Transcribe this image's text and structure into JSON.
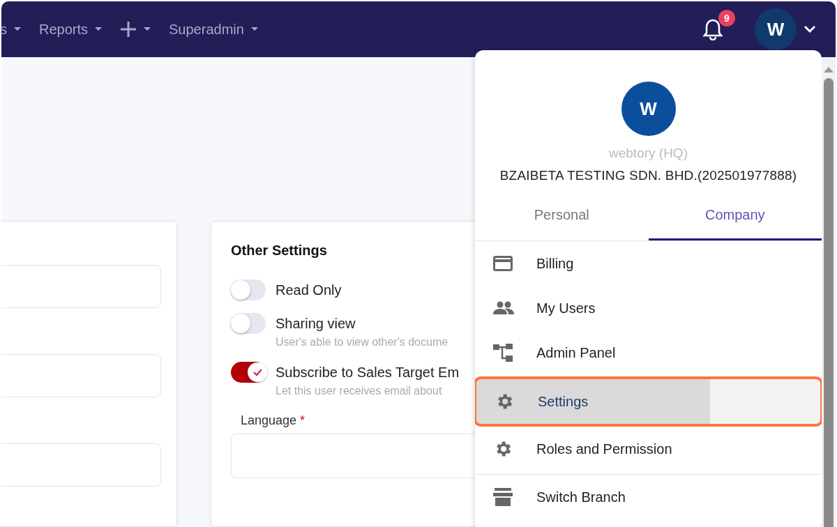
{
  "nav": {
    "items": [
      {
        "kind": "text",
        "label": "s"
      },
      {
        "kind": "text",
        "label": "Reports"
      },
      {
        "kind": "add"
      },
      {
        "kind": "text",
        "label": "Superadmin"
      }
    ],
    "notifications": {
      "count": "9"
    },
    "avatar": {
      "initial": "W"
    }
  },
  "other_settings": {
    "title": "Other Settings",
    "toggles": [
      {
        "label": "Read Only",
        "on": false
      },
      {
        "label": "Sharing view",
        "hint": "User's able to view other's docume",
        "on": false
      },
      {
        "label": "Subscribe to Sales Target Em",
        "hint": "Let this user receives email about",
        "on": true
      }
    ],
    "language": {
      "label": "Language",
      "required_mark": "*"
    }
  },
  "account_menu": {
    "avatar": "W",
    "branch": "webtory (HQ)",
    "company": "BZAIBETA TESTING SDN. BHD.(202501977888)",
    "tabs": [
      {
        "label": "Personal",
        "selected": false
      },
      {
        "label": "Company",
        "selected": true
      }
    ],
    "items": [
      {
        "kind": "card",
        "label": "Billing",
        "highlighted": false
      },
      {
        "kind": "users",
        "label": "My Users",
        "highlighted": false
      },
      {
        "kind": "tree",
        "label": "Admin Panel",
        "highlighted": false
      },
      {
        "kind": "gear",
        "label": "Settings",
        "highlighted": true
      },
      {
        "kind": "gear",
        "label": "Roles and Permission",
        "highlighted": false
      },
      {
        "kind": "store",
        "label": "Switch Branch",
        "highlighted": false,
        "divider_before": true
      }
    ]
  }
}
